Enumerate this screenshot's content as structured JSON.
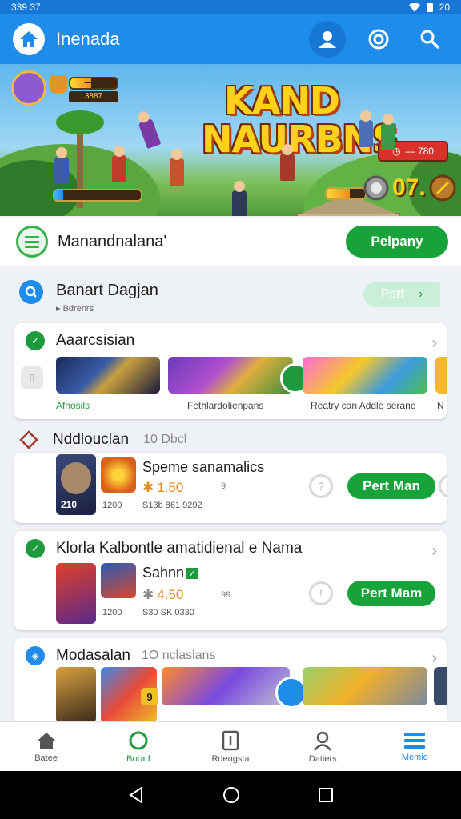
{
  "status_bar": {
    "time": "339 37",
    "battery": "20"
  },
  "app_bar": {
    "title": "Inenada"
  },
  "hero": {
    "game_title_line1": "KAND",
    "game_title_line2": "NAURBNS",
    "hp_label": "— —",
    "hp_sub": "3887",
    "top_chip": "— 780",
    "score_text": "07.",
    "hp_level": 0.45,
    "bottom_left_level": 0.1,
    "bottom_right_level": 0.6
  },
  "featured": {
    "title": "Manandnalana'",
    "button": "Pelpany"
  },
  "section": {
    "title": "Banart Dagjan",
    "subtitle": "Bdrenrs",
    "pill": "Pert"
  },
  "card1": {
    "title": "Aaarcsisian",
    "items": [
      {
        "label": "Afnosils"
      },
      {
        "label": "Fethlardolienpans"
      },
      {
        "label": "Reatry can Addle serane"
      },
      {
        "label": "N"
      }
    ]
  },
  "card2": {
    "title": "Nddlouclan",
    "meta": "10 Dbcl",
    "app_name": "Speme sanamalics",
    "rating": "1.50",
    "rating_icon": "star-icon",
    "extra": "9",
    "left_num": "210",
    "sub1": "1200",
    "sub2": "S13b 861 9292",
    "button": "Pert Man"
  },
  "card3": {
    "title": "Klorla Kalbontle amatidienal e Nama",
    "app_name": "Sahnn",
    "rating": "4.50",
    "extra": "99",
    "sub1": "1200",
    "sub2": "S30 SK 0330",
    "button": "Pert Mam"
  },
  "card4": {
    "title": "Modasalan",
    "meta": "1O nclaslans",
    "badge_text": "9"
  },
  "bottom_nav": [
    {
      "label": "Batee",
      "icon": "home-icon"
    },
    {
      "label": "Borad",
      "icon": "chat-circle-icon"
    },
    {
      "label": "Rdengsta",
      "icon": "tablet-icon"
    },
    {
      "label": "Datiers",
      "icon": "person-icon"
    },
    {
      "label": "Memio",
      "icon": "menu-icon"
    }
  ],
  "colors": {
    "primary": "#1f8cea",
    "green": "#18a33a",
    "hero_title": "#ffd21a"
  }
}
